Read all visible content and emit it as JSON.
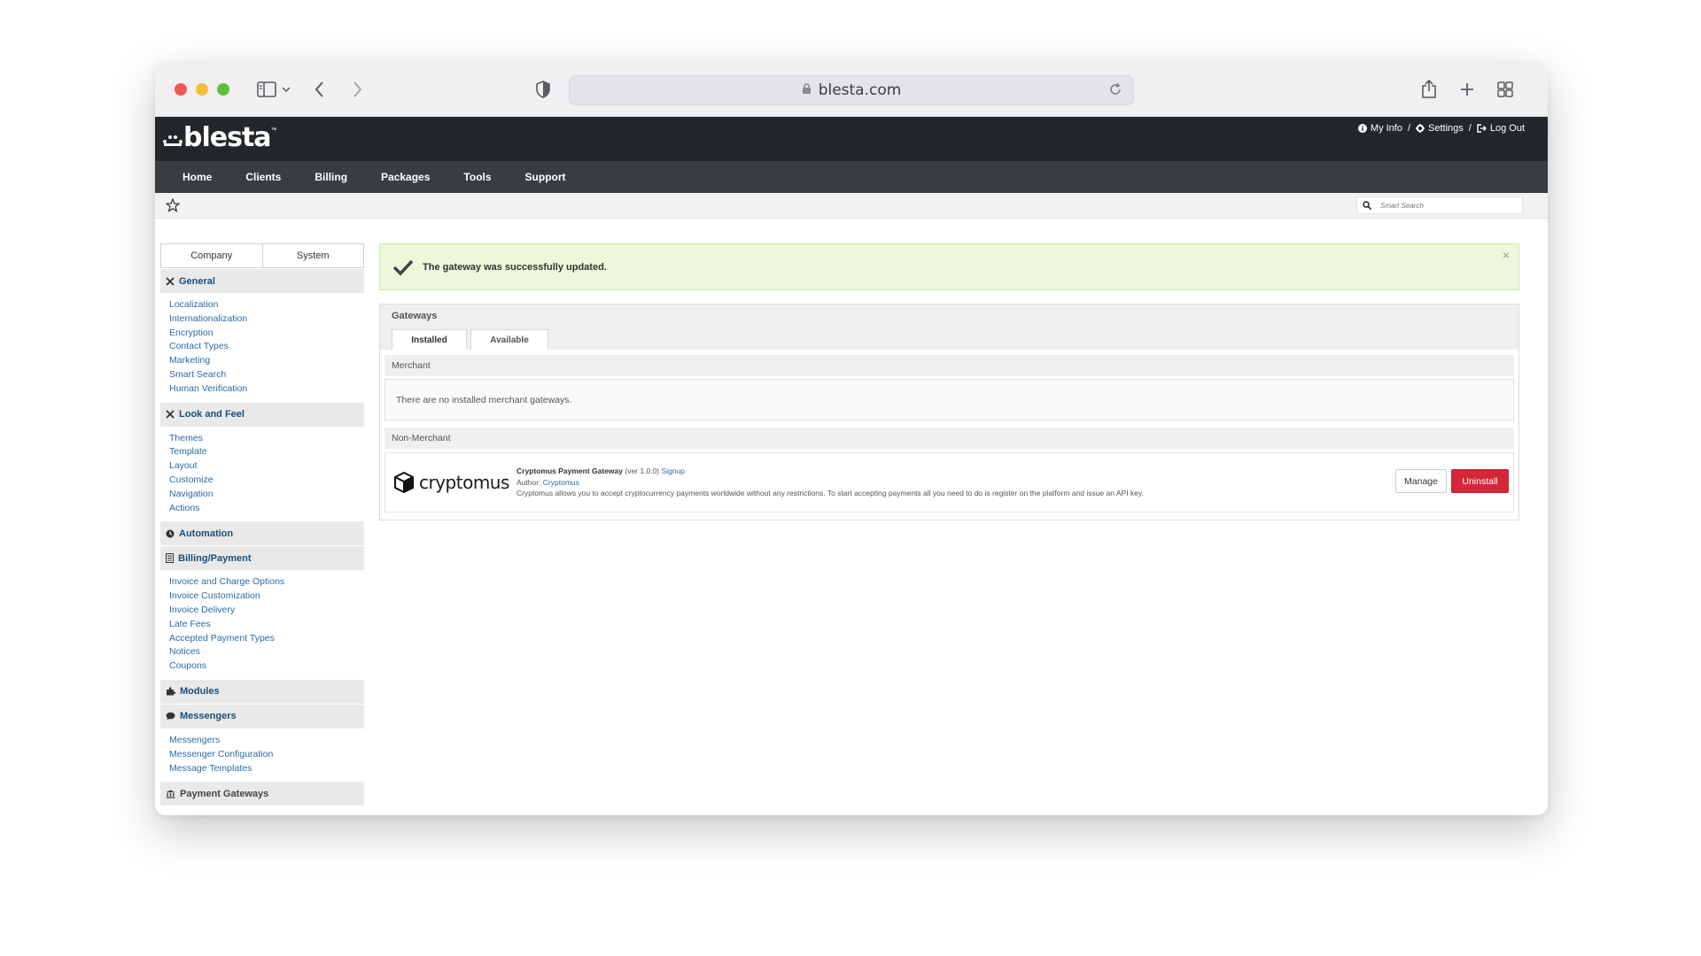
{
  "browser": {
    "url": "blesta.com"
  },
  "app": {
    "logo_text": "blesta",
    "logo_tm": "™",
    "usermenu": {
      "my_info": "My Info",
      "sep1": "/",
      "settings": "Settings",
      "sep2": "/",
      "logout": "Log Out"
    },
    "nav": [
      "Home",
      "Clients",
      "Billing",
      "Packages",
      "Tools",
      "Support"
    ],
    "search_placeholder": "Smart Search"
  },
  "sidebar": {
    "tabs": [
      "Company",
      "System"
    ],
    "sections": {
      "general": {
        "title": "General",
        "links": [
          "Localization",
          "Internationalization",
          "Encryption",
          "Contact Types",
          "Marketing",
          "Smart Search",
          "Human Verification"
        ]
      },
      "look": {
        "title": "Look and Feel",
        "links": [
          "Themes",
          "Template",
          "Layout",
          "Customize",
          "Navigation",
          "Actions"
        ]
      },
      "automation": {
        "title": "Automation"
      },
      "billing": {
        "title": "Billing/Payment",
        "links": [
          "Invoice and Charge Options",
          "Invoice Customization",
          "Invoice Delivery",
          "Late Fees",
          "Accepted Payment Types",
          "Notices",
          "Coupons"
        ]
      },
      "modules": {
        "title": "Modules"
      },
      "messengers": {
        "title": "Messengers",
        "links": [
          "Messengers",
          "Messenger Configuration",
          "Message Templates"
        ]
      },
      "payment_gateways": {
        "title": "Payment Gateways"
      }
    }
  },
  "main": {
    "alert": "The gateway was successfully updated.",
    "alert_close": "×",
    "panel_title": "Gateways",
    "tabs": [
      "Installed",
      "Available"
    ],
    "merchant_title": "Merchant",
    "merchant_empty": "There are no installed merchant gateways.",
    "nonmerchant_title": "Non-Merchant",
    "gateway": {
      "logo_text": "cryptomus",
      "name": "Cryptomus Payment Gateway",
      "version": "(ver 1.0.0)",
      "signup": "Signup",
      "author_label": "Author:",
      "author": "Cryptomus",
      "description": "Cryptomus allows you to accept cryptocurrency payments worldwide without any restrictions. To start accepting payments all you need to do is register on the platform and issue an API key.",
      "manage": "Manage",
      "uninstall": "Uninstall"
    }
  }
}
